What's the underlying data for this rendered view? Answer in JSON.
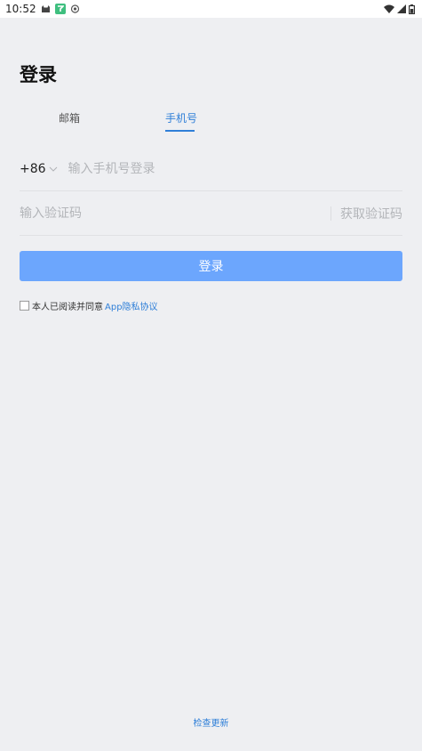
{
  "status_bar": {
    "time": "10:52",
    "left_icons": [
      "cat-icon",
      "green-app-icon",
      "eye-icon"
    ],
    "right_icons": [
      "wifi-icon",
      "signal-icon",
      "battery-icon"
    ]
  },
  "title": "登录",
  "tabs": [
    {
      "label": "邮箱",
      "active": false
    },
    {
      "label": "手机号",
      "active": true
    }
  ],
  "phone": {
    "country_code": "+86",
    "placeholder": "输入手机号登录",
    "value": ""
  },
  "code": {
    "placeholder": "输入验证码",
    "value": "",
    "get_code_label": "获取验证码"
  },
  "login_button": "登录",
  "agreement": {
    "checked": false,
    "text": "本人已阅读并同意",
    "link": "App隐私协议"
  },
  "check_update": "检查更新",
  "colors": {
    "accent": "#2f7fd8",
    "button": "#6ca6fd",
    "background": "#eeeff2"
  }
}
